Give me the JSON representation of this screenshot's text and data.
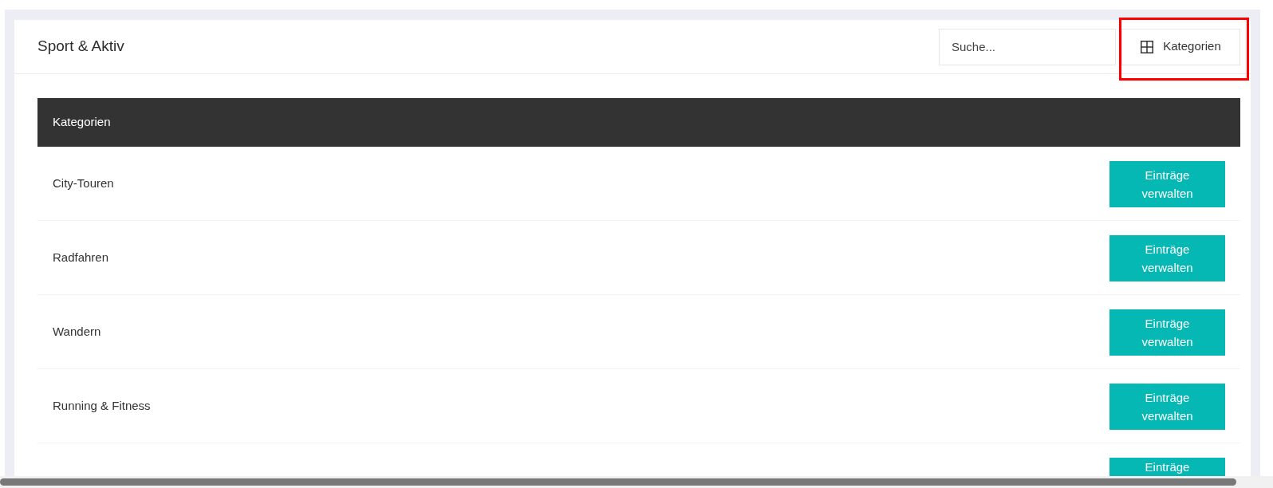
{
  "header": {
    "title": "Sport & Aktiv",
    "search": {
      "placeholder": "Suche..."
    },
    "categories_button": {
      "label": "Kategorien",
      "highlighted": true
    }
  },
  "table": {
    "columns": [
      "Kategorien"
    ],
    "rows": [
      {
        "name": "City-Touren",
        "action": "Einträge verwalten"
      },
      {
        "name": "Radfahren",
        "action": "Einträge verwalten"
      },
      {
        "name": "Wandern",
        "action": "Einträge verwalten"
      },
      {
        "name": "Running & Fitness",
        "action": "Einträge verwalten"
      },
      {
        "action": "Einträge"
      }
    ]
  }
}
